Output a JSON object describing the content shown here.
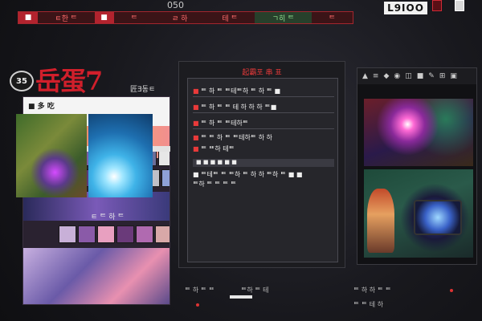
{
  "header": {
    "number_label": "050",
    "segments": [
      {
        "text": "■",
        "style": "red"
      },
      {
        "text": "ㅌ한 ᄐ",
        "style": "dark"
      },
      {
        "text": "■",
        "style": "red"
      },
      {
        "text": "ᄐ",
        "style": "dark"
      },
      {
        "text": "ㄹ 하",
        "style": "dark"
      },
      {
        "text": "테 ᄐ",
        "style": "dark"
      },
      {
        "text": "ㄱ히 ᄐ",
        "style": "green"
      },
      {
        "text": "ᄐ",
        "style": "dark"
      }
    ],
    "brand": "L9IOO"
  },
  "logo": {
    "badge": "35",
    "title": "岳蛋7",
    "subtitle": "匠Ǝ동ㅌ"
  },
  "left_panel": {
    "title": "■ 多 吃 ",
    "tag": "■",
    "caption": "ㅌ ᄐ 하 ᄐ",
    "thumb_colors_row1": [
      "#c48a7a",
      "#e7a08b",
      "#8b3b6b",
      "#7b5ea8",
      "#cfc1c9",
      "#c3a9b7",
      "#6c6f9a",
      "#e7e7e7"
    ],
    "thumb_colors_row2": [
      "#6c79c8",
      "#7c5aa8",
      "#5b3a7a",
      "#2f3a7a",
      "#a44a6a",
      "#c0c0c8",
      "#8fa0d8",
      "#3a4a8a"
    ],
    "thumb_colors_row3": [
      "#c8b0d8",
      "#8a5aa8",
      "#e8a0c0",
      "#6a3a7a",
      "#b06ab0",
      "#d8a8a8",
      "#6a5aa8",
      "#f0c0d0"
    ]
  },
  "center_panel": {
    "title": "起霸포 串 표",
    "rows": [
      {
        "lead": "■ ",
        "text": "ᄐ 하 ᄐ ᄐ테ᄐ하 ᄐ 하 ᄐ ■"
      },
      {
        "lead": "■ ",
        "text": "ᄐ 하 ᄐ ᄐ 테 하 하 하 ᄐ■"
      },
      {
        "lead": "■ ",
        "text": "ᄐ 하 ᄐ ᄐ테하ᄐ"
      },
      {
        "lead": "■ ",
        "text": "ᄐ ᄐ 하 ᄐ ᄐ테하ᄐ 하 하"
      },
      {
        "lead": "■ ",
        "text": "ᄐ ᄐᄐ하 테ᄐ"
      }
    ],
    "toolbar_label": "■ ■ ■ ■ ■ ■",
    "subrow": "■ ᄐ테ᄐ ᄐ ᄐ하 ᄐ 하 하 ᄐ하 ᄐ ■ ■",
    "subrow2": "ᄐ하 ᄐ ᄐ ᄐ ᄐ"
  },
  "right_panel": {
    "tools": [
      "▲",
      "≡",
      "◆",
      "◉",
      "◫",
      "■",
      "✎",
      "⊞",
      "▣"
    ]
  },
  "bottom": {
    "labels": [
      "ᄐ 하 ᄐ ᄐᄐ",
      "ᄐ하 ᄐ 테",
      "ᄐ 하 하 ᄐ ᄐ",
      "ᄐ ᄐ 테 하"
    ]
  },
  "colors": {
    "accent_red": "#d01f2b",
    "panel_bg": "#1c1c20",
    "background": "#141418"
  }
}
